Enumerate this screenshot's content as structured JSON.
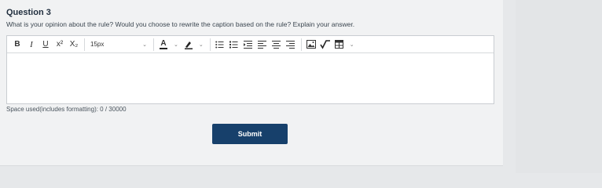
{
  "question": {
    "title": "Question 3",
    "prompt": "What is your opinion about the rule? Would you choose to rewrite the caption based on the rule? Explain your answer."
  },
  "editor": {
    "toolbar": {
      "bold": "B",
      "italic": "I",
      "underline": "U",
      "superscript": "x²",
      "subscript": "X₂",
      "font_size_value": "15px",
      "text_color_icon": "A",
      "icons": [
        "bold-icon",
        "italic-icon",
        "underline-icon",
        "superscript-icon",
        "subscript-icon",
        "chevron-down-icon",
        "text-color-icon",
        "highlight-icon",
        "unordered-list-icon",
        "ordered-list-icon",
        "indent-icon",
        "align-left-icon",
        "align-center-icon",
        "align-right-icon",
        "image-icon",
        "math-icon",
        "table-icon"
      ]
    },
    "content": ""
  },
  "space_used": "Space used(includes formatting): 0 / 30000",
  "submit_label": "Submit",
  "colors": {
    "submit_bg": "#17406b",
    "background": "#f1f2f3",
    "side_panel": "#e3e5e7"
  }
}
